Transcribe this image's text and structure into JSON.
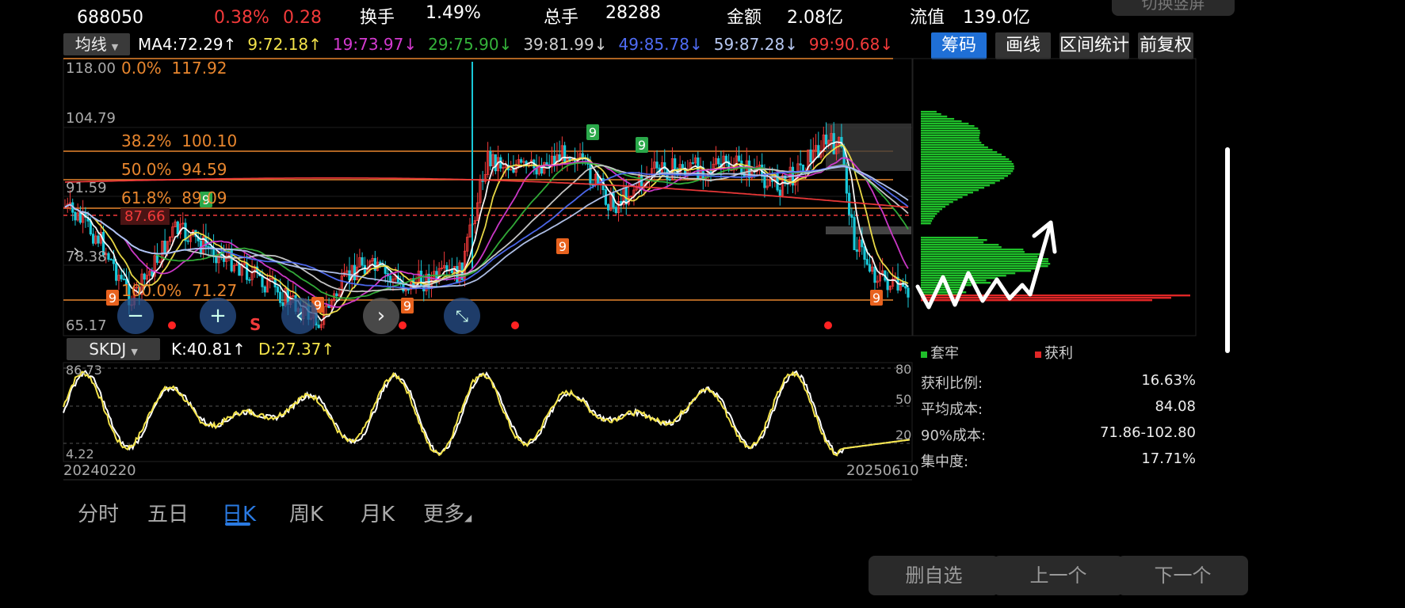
{
  "header": {
    "code": "688050",
    "change_pct": "0.38%",
    "change_amt": "0.28",
    "turnover_label": "换手",
    "turnover_value": "1.49%",
    "volume_label": "总手",
    "volume_value": "28288",
    "amount_label": "金额",
    "amount_value": "2.08亿",
    "float_label": "流值",
    "float_value": "139.0亿",
    "switch_label": "切换竖屏"
  },
  "ma_bar": {
    "selector": "均线",
    "items": [
      {
        "text": "MA4:72.29",
        "arrow": "↑",
        "color": "#ffffff"
      },
      {
        "text": "9:72.18",
        "arrow": "↑",
        "color": "#f3e34a"
      },
      {
        "text": "19:73.97",
        "arrow": "↓",
        "color": "#d43ad0"
      },
      {
        "text": "29:75.90",
        "arrow": "↓",
        "color": "#34b23a"
      },
      {
        "text": "39:81.99",
        "arrow": "↓",
        "color": "#cfcfcf"
      },
      {
        "text": "49:85.78",
        "arrow": "↓",
        "color": "#4f6cf5"
      },
      {
        "text": "59:87.28",
        "arrow": "↓",
        "color": "#b6c7f0"
      },
      {
        "text": "99:90.68",
        "arrow": "↓",
        "color": "#f23a3a"
      }
    ]
  },
  "tools": {
    "chips": "筹码",
    "draw": "画线",
    "range_stats": "区间统计",
    "adjust": "前复权"
  },
  "price_axis": {
    "top": "118.00",
    "l2": "104.79",
    "l3": "91.59",
    "l4": "78.38",
    "bottom": "65.17"
  },
  "fib_levels": [
    {
      "label": "0.0%",
      "price": "117.92"
    },
    {
      "label": "38.2%",
      "price": "100.10"
    },
    {
      "label": "50.0%",
      "price": "94.59"
    },
    {
      "label": "61.8%",
      "price": "89.09"
    },
    {
      "label": "100.0%",
      "price": "71.27"
    }
  ],
  "avg_line_label": "87.66",
  "sell_marker": "S",
  "nine_marker": "9",
  "indicator": {
    "selector": "SKDJ",
    "k": "K:40.81",
    "k_arrow": "↑",
    "d": "D:27.37",
    "d_arrow": "↑",
    "axis_top": "86.73",
    "axis_bottom": "4.22",
    "levels": [
      "80",
      "50",
      "20"
    ]
  },
  "date_range": {
    "start": "20240220",
    "end": "20250610"
  },
  "chips_panel": {
    "legend_trapped": "套牢",
    "legend_profit": "获利",
    "profit_ratio_label": "获利比例:",
    "profit_ratio_value": "16.63%",
    "avg_cost_label": "平均成本:",
    "avg_cost_value": "84.08",
    "cost90_label": "90%成本:",
    "cost90_value": "71.86-102.80",
    "concentration_label": "集中度:",
    "concentration_value": "17.71%"
  },
  "period_tabs": [
    "分时",
    "五日",
    "日K",
    "周K",
    "月K",
    "更多"
  ],
  "active_tab": "日K",
  "bottom_buttons": {
    "remove_watch": "删自选",
    "prev": "上一个",
    "next": "下一个"
  },
  "colors": {
    "up": "#f23a3a",
    "down": "#19c8d8",
    "fib": "#e8862e",
    "accent": "#1f6fd6",
    "chip_green": "#1fbf2a",
    "chip_red": "#e02626"
  }
}
